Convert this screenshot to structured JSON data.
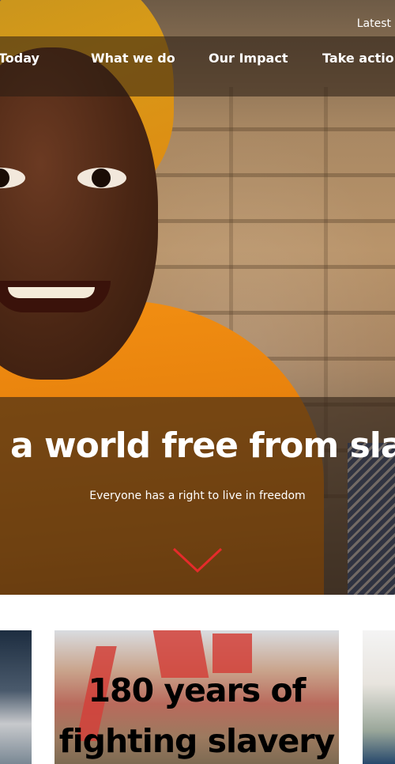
{
  "header": {
    "utility_link": "Latest",
    "nav": [
      {
        "label": "y Today"
      },
      {
        "label": "What we do"
      },
      {
        "label": "Our Impact"
      },
      {
        "label": "Take action"
      }
    ]
  },
  "hero": {
    "title": "r a world free from slave",
    "subtitle": "Everyone has a right to live in freedom",
    "scroll_icon": "chevron-down-icon",
    "accent_color": "#e52b2b"
  },
  "cards": {
    "featured_title_line1": "180 years of",
    "featured_title_line2": "fighting slavery"
  }
}
